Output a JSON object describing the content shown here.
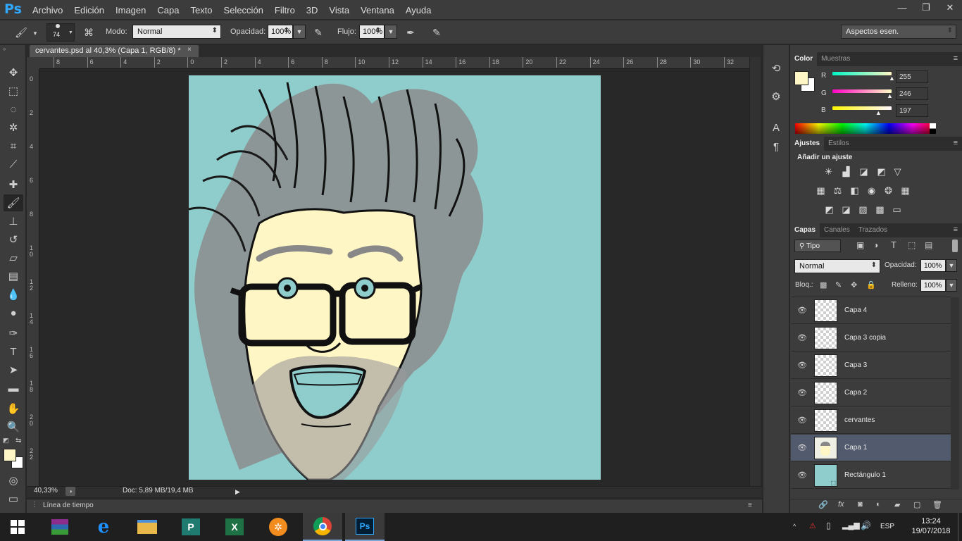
{
  "menubar": {
    "logo": "Ps",
    "items": [
      "Archivo",
      "Edición",
      "Imagen",
      "Capa",
      "Texto",
      "Selección",
      "Filtro",
      "3D",
      "Vista",
      "Ventana",
      "Ayuda"
    ],
    "window_controls": [
      "—",
      "❐",
      "✕"
    ]
  },
  "options": {
    "brush_size": "74",
    "mode_label": "Modo:",
    "mode_value": "Normal",
    "opacity_label": "Opacidad:",
    "opacity_value": "100%",
    "flow_label": "Flujo:",
    "flow_value": "100%",
    "workspace": "Aspectos esen."
  },
  "document": {
    "tab_title": "cervantes.psd al 40,3% (Capa 1, RGB/8) *",
    "close": "×",
    "ruler_h": [
      "8",
      "6",
      "4",
      "2",
      "0",
      "2",
      "4",
      "6",
      "8",
      "10",
      "12",
      "14",
      "16",
      "18",
      "20",
      "22",
      "24",
      "26",
      "28",
      "30",
      "32"
    ],
    "ruler_v": [
      "0",
      "2",
      "4",
      "6",
      "8",
      "10",
      "12",
      "14",
      "16",
      "18",
      "20",
      "22"
    ],
    "zoom": "40,33%",
    "doc_info": "Doc: 5,89 MB/19,4 MB",
    "timeline": "Línea de tiempo"
  },
  "color_panel": {
    "tabs": [
      "Color",
      "Muestras"
    ],
    "r_label": "R",
    "r_value": "255",
    "g_label": "G",
    "g_value": "246",
    "b_label": "B",
    "b_value": "197",
    "r_level": 1.0,
    "g_level": 0.965,
    "b_level": 0.773,
    "foreground": "#fff6c5"
  },
  "adjust_panel": {
    "tabs": [
      "Ajustes",
      "Estilos"
    ],
    "heading": "Añadir un ajuste"
  },
  "layers_panel": {
    "tabs": [
      "Capas",
      "Canales",
      "Trazados"
    ],
    "filter": "Tipo",
    "blend": "Normal",
    "opacity_label": "Opacidad:",
    "opacity_value": "100%",
    "lock_label": "Bloq.:",
    "fill_label": "Relleno:",
    "fill_value": "100%",
    "layers": [
      "Capa 4",
      "Capa 3 copia",
      "Capa 3",
      "Capa 2",
      "cervantes",
      "Capa 1",
      "Rectángulo 1"
    ],
    "selected": "Capa 1"
  },
  "taskbar": {
    "lang": "ESP",
    "time": "13:24",
    "date": "19/07/2018"
  }
}
